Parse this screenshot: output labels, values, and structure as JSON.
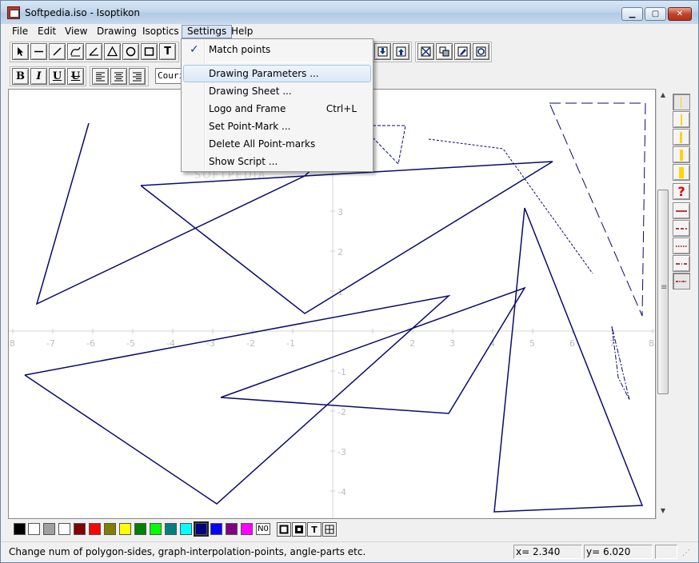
{
  "window": {
    "title": "Softpedia.iso - Isoptikon"
  },
  "menubar": {
    "items": [
      {
        "id": "file",
        "label": "File"
      },
      {
        "id": "edit",
        "label": "Edit"
      },
      {
        "id": "view",
        "label": "View"
      },
      {
        "id": "drawing",
        "label": "Drawing"
      },
      {
        "id": "isoptics",
        "label": "Isoptics"
      },
      {
        "id": "settings",
        "label": "Settings"
      },
      {
        "id": "help",
        "label": "Help"
      }
    ],
    "active": "settings"
  },
  "settings_menu": {
    "items": [
      {
        "label": "Match points",
        "checked": true,
        "shortcut": ""
      },
      {
        "label": "Drawing Parameters ...",
        "highlighted": true,
        "shortcut": ""
      },
      {
        "label": "Drawing Sheet ...",
        "shortcut": ""
      },
      {
        "label": "Logo and Frame",
        "shortcut": "Ctrl+L"
      },
      {
        "label": "Set Point-Mark ...",
        "shortcut": ""
      },
      {
        "label": "Delete All Point-marks",
        "shortcut": ""
      },
      {
        "label": "Show Script ...",
        "shortcut": ""
      }
    ]
  },
  "format_toolbar": {
    "bold": "B",
    "italic": "I",
    "underline": "U",
    "strike": "U",
    "font_name": "Courier"
  },
  "toolbar": {
    "text_tool": "T"
  },
  "canvas": {
    "x_ticks": [
      "8",
      "-7",
      "-6",
      "-5",
      "-4",
      "-3",
      "-2",
      "-1",
      "2",
      "3",
      "4",
      "5",
      "6",
      "7",
      "8"
    ],
    "y_ticks_pos": [
      "3",
      "2",
      "1"
    ],
    "y_ticks_neg": [
      "-1",
      "-2",
      "-3",
      "-4"
    ]
  },
  "palette": {
    "colors": [
      "#000000",
      "#ffffff",
      "#a0a0a0",
      "#ffffff",
      "#800000",
      "#ff0000",
      "#808000",
      "#ffff00",
      "#008000",
      "#00ff00",
      "#008080",
      "#00ffff",
      "#000080",
      "#0000ff",
      "#800080",
      "#ff00ff"
    ],
    "selected_index": 12,
    "no_fill_label": "N0"
  },
  "fill_toolbar": {
    "text_label": "T"
  },
  "rightpanel": {
    "help_glyph": "?"
  },
  "statusbar": {
    "message": "Change num of polygon-sides, graph-interpolation-points, angle-parts etc.",
    "x_readout": "x= 2.340",
    "y_readout": "y= 6.020"
  },
  "colors": {
    "shape_stroke": "#0a0a6e",
    "accent": "#1a3c78"
  }
}
